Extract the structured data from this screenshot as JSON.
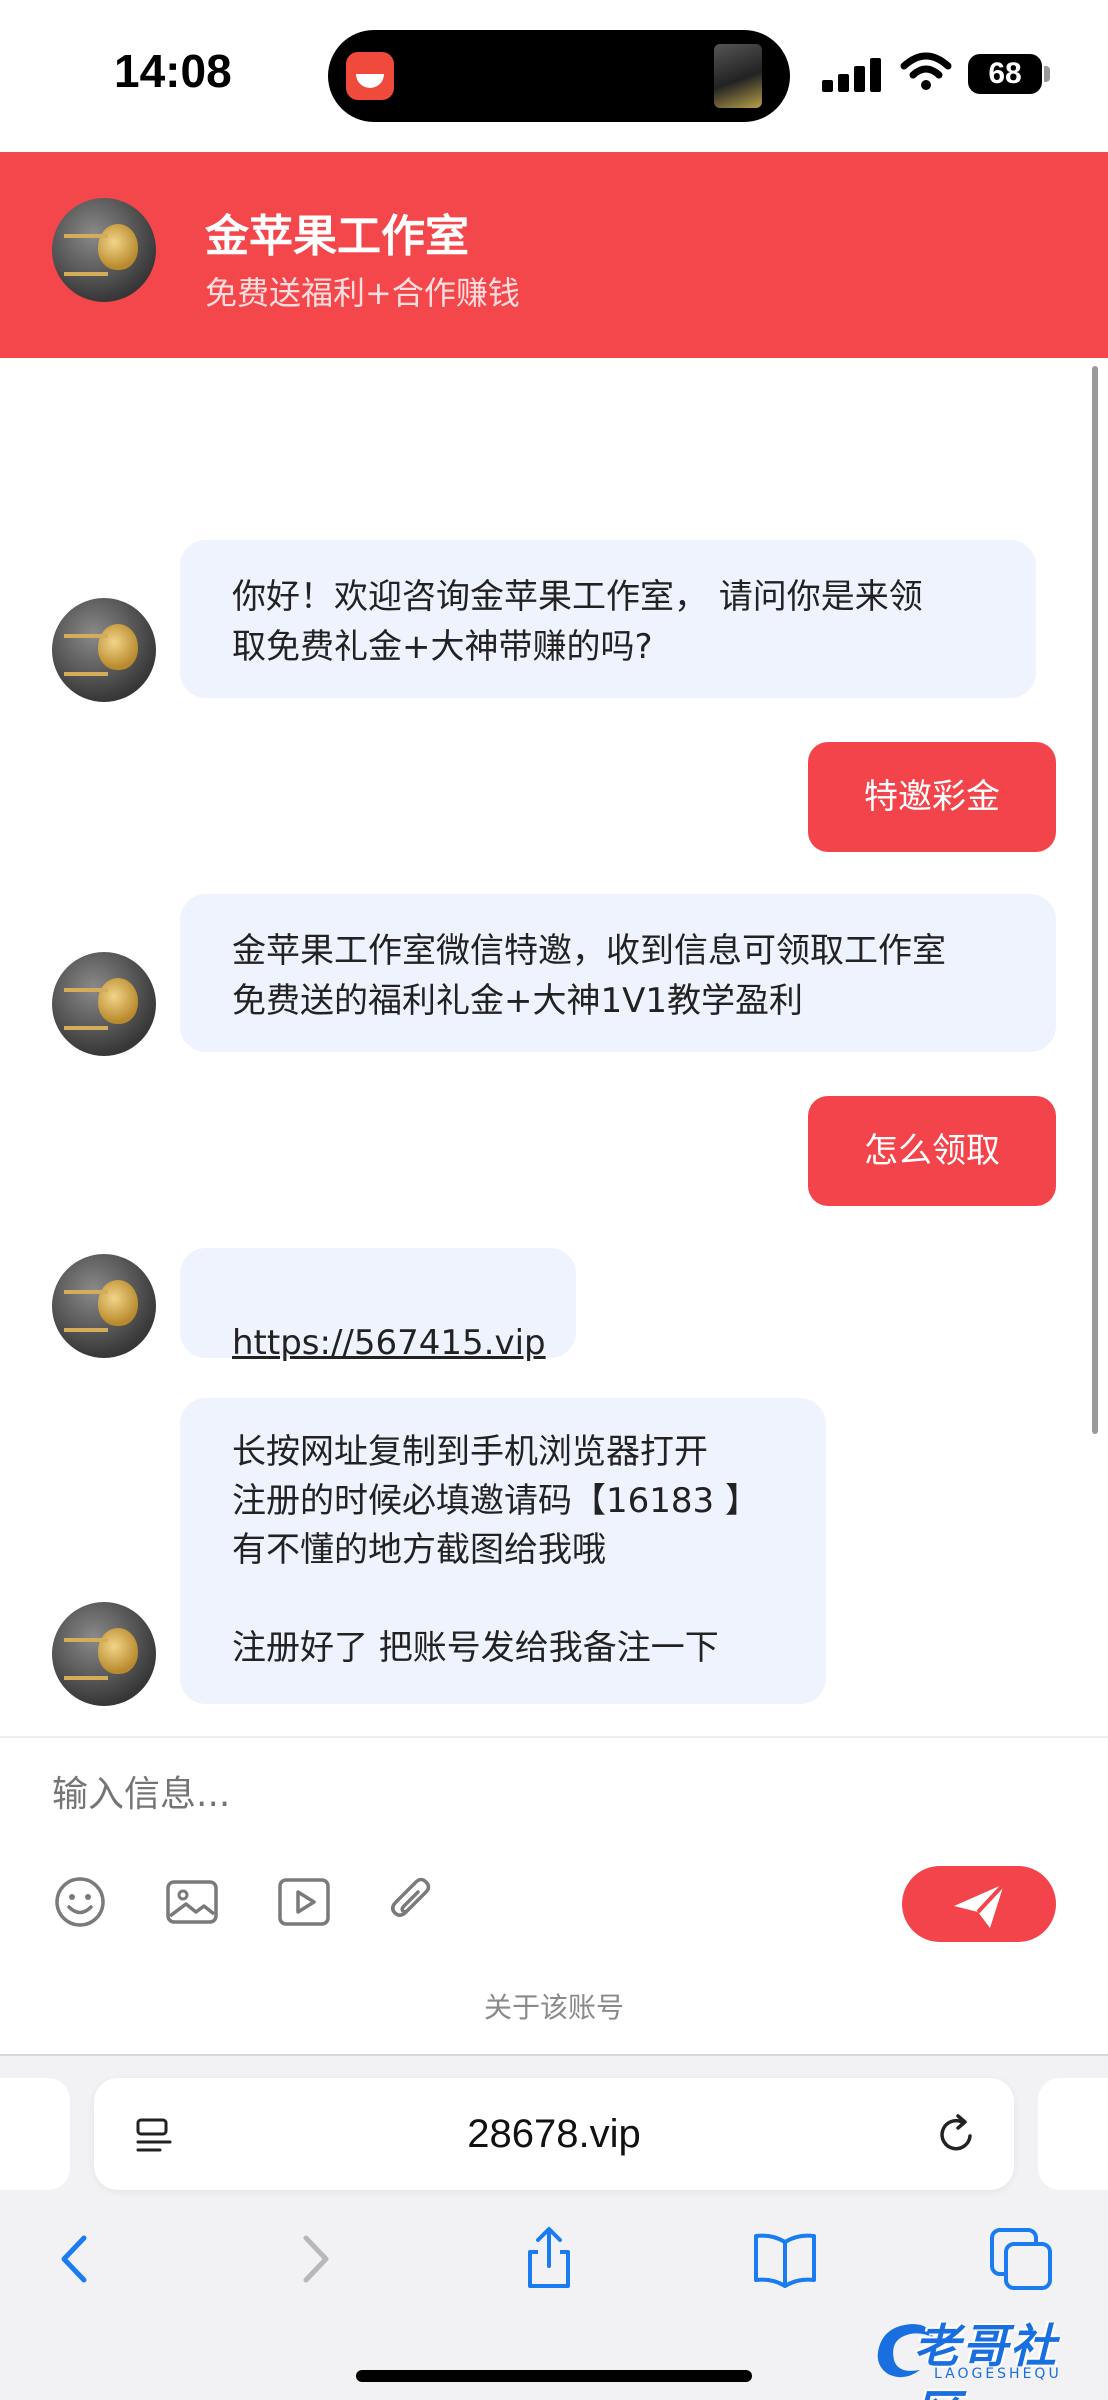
{
  "status_bar": {
    "time": "14:08",
    "battery": "68"
  },
  "header": {
    "title": "金苹果工作室",
    "subtitle": "免费送福利+合作赚钱"
  },
  "messages": [
    {
      "from": "agent",
      "text": "你好！欢迎咨询金苹果工作室， 请问你是来领\n取免费礼金+大神带赚的吗?"
    },
    {
      "from": "user",
      "text": "特邀彩金"
    },
    {
      "from": "agent",
      "text": "金苹果工作室微信特邀，收到信息可领取工作室\n免费送的福利礼金+大神1V1教学盈利"
    },
    {
      "from": "user",
      "text": "怎么领取"
    },
    {
      "from": "agent",
      "text": "https://567415.vip"
    },
    {
      "from": "agent",
      "text": "长按网址复制到手机浏览器打开\n注册的时候必填邀请码【16183 】\n有不懂的地方截图给我哦\n\n注册好了 把账号发给我备注一下"
    }
  ],
  "composer": {
    "placeholder": "输入信息...",
    "tools": [
      "emoji-icon",
      "image-icon",
      "video-icon",
      "attachment-icon"
    ],
    "send_icon": "send-icon",
    "about_link": "关于该账号"
  },
  "browser": {
    "url": "28678.vip"
  },
  "watermark": {
    "text": "老哥社区",
    "sub": "LAOGESHEQU"
  },
  "colors": {
    "accent": "#f4474b",
    "bubble_in": "#eef3fd",
    "bubble_out": "#f2444a"
  }
}
